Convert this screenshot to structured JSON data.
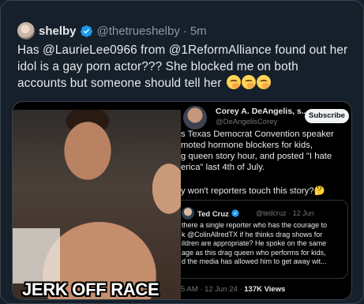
{
  "tweet": {
    "author_name": "shelby",
    "author_handle": "@thetrueshelby",
    "separator": "·",
    "time": "5m",
    "text": "Has @LaurieLee0966 from @1ReformAlliance found out her idol is a gay porn actor??? She blocked me on both accounts but someone should tell her",
    "emoji_count": 3
  },
  "media": {
    "left_image_caption": "JERK OFF RACE",
    "screenshot": {
      "author_name": "Corey A. DeAngelis, s...",
      "author_handle": "@DeAngelisCorey",
      "subscribe_label": "Subscribe",
      "lines": [
        "s Texas Democrat Convention speaker",
        "moted hormone blockers for kids,",
        "g queen story hour, and posted \"I hate",
        "erica\" last 4th of July."
      ],
      "question": "y won't reporters touch this story?🤔",
      "quoted": {
        "name": "Ted Cruz",
        "handle": "@tedcruz",
        "date": "12 Jun",
        "lines": [
          "there a single reporter who has the courage to",
          "k @ColinAllredTX if he thinks drag shows for",
          "ildren are appropriate? He spoke on the same",
          "age as this drag queen who performs for kids,",
          "d the media has allowed him to get away wit..."
        ]
      },
      "footer_time": "5 AM · 12 Jun 24 ·",
      "footer_views": "137K Views"
    }
  },
  "colors": {
    "background": "#15202b",
    "verified_blue": "#1d9bf0",
    "secondary_text": "#8b98a5"
  }
}
